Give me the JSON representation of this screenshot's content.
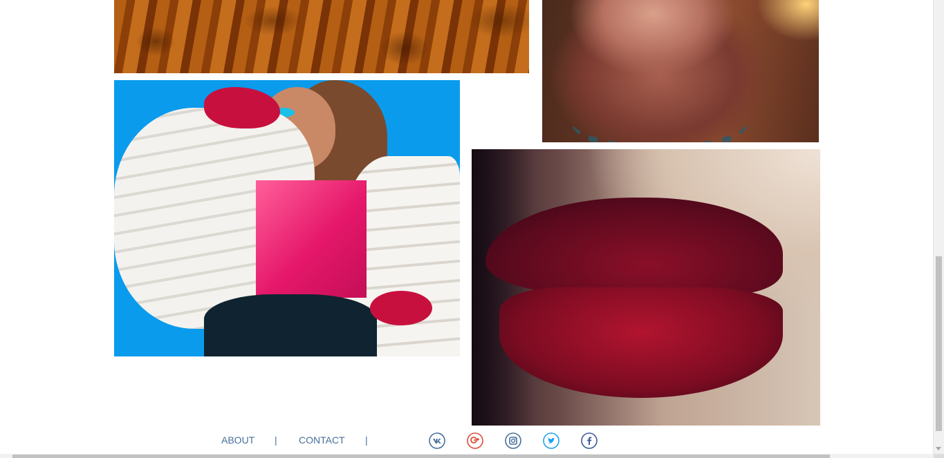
{
  "gallery": {
    "photos": [
      {
        "name": "fur-coat-photo"
      },
      {
        "name": "necklace-photo"
      },
      {
        "name": "fashion-model-photo"
      },
      {
        "name": "red-lips-photo"
      }
    ]
  },
  "footer": {
    "links": [
      {
        "label": "ABOUT"
      },
      {
        "label": "CONTACT"
      }
    ],
    "separator": "|",
    "social": [
      {
        "name": "vk",
        "icon": "vk-icon",
        "color": "#466f9a"
      },
      {
        "name": "google-plus",
        "icon": "google-plus-icon",
        "color": "#dd4b39"
      },
      {
        "name": "instagram",
        "icon": "instagram-icon",
        "color": "#466f9a"
      },
      {
        "name": "twitter",
        "icon": "twitter-icon",
        "color": "#1da1f2"
      },
      {
        "name": "facebook",
        "icon": "facebook-icon",
        "color": "#3b5998"
      }
    ]
  },
  "colors": {
    "link": "#466f9a",
    "background": "#ffffff"
  }
}
